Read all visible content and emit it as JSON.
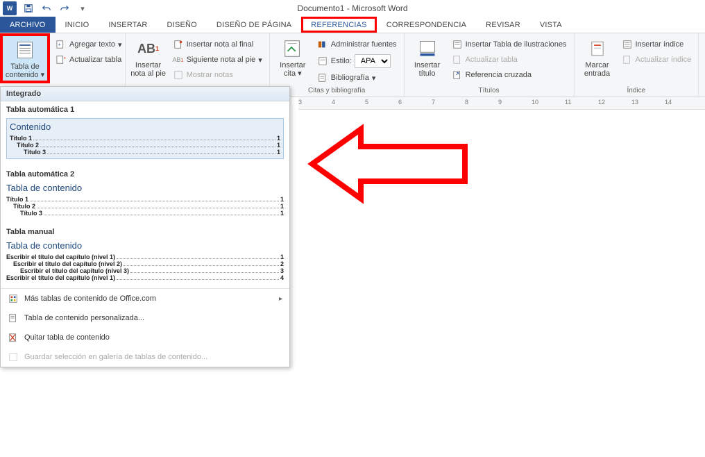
{
  "titlebar": {
    "title": "Documento1 - Microsoft Word"
  },
  "tabs": {
    "file": "ARCHIVO",
    "home": "INICIO",
    "insert": "INSERTAR",
    "design": "DISEÑO",
    "layout": "DISEÑO DE PÁGINA",
    "references": "REFERENCIAS",
    "mailings": "CORRESPONDENCIA",
    "review": "REVISAR",
    "view": "VISTA"
  },
  "ribbon": {
    "toc": {
      "label": "Tabla de\ncontenido",
      "add_text": "Agregar texto",
      "update": "Actualizar tabla"
    },
    "footnotes": {
      "big": "Insertar\nnota al pie",
      "endnote": "Insertar nota al final",
      "next": "Siguiente nota al pie",
      "show": "Mostrar notas"
    },
    "citations": {
      "big": "Insertar\ncita",
      "manage": "Administrar fuentes",
      "style_label": "Estilo:",
      "style_value": "APA",
      "biblio": "Bibliografía",
      "group": "Citas y bibliografía"
    },
    "captions": {
      "big": "Insertar\ntítulo",
      "insert_tof": "Insertar Tabla de ilustraciones",
      "update": "Actualizar tabla",
      "crossref": "Referencia cruzada",
      "group": "Títulos"
    },
    "index": {
      "big": "Marcar\nentrada",
      "insert": "Insertar índice",
      "update": "Actualizar índice",
      "group": "Índice"
    }
  },
  "ruler": [
    "3",
    "4",
    "5",
    "6",
    "7",
    "8",
    "9",
    "10",
    "11",
    "12",
    "13",
    "14"
  ],
  "gallery": {
    "header": "Integrado",
    "auto1": {
      "name": "Tabla automática 1",
      "title": "Contenido",
      "lines": [
        {
          "txt": "Título 1",
          "pg": "1",
          "indent": 0
        },
        {
          "txt": "Título 2",
          "pg": "1",
          "indent": 1
        },
        {
          "txt": "Título 3",
          "pg": "1",
          "indent": 2
        }
      ]
    },
    "auto2": {
      "name": "Tabla automática 2",
      "title": "Tabla de contenido",
      "lines": [
        {
          "txt": "Título 1",
          "pg": "1",
          "indent": 0
        },
        {
          "txt": "Título 2",
          "pg": "1",
          "indent": 1
        },
        {
          "txt": "Título 3",
          "pg": "1",
          "indent": 2
        }
      ]
    },
    "manual": {
      "name": "Tabla manual",
      "title": "Tabla de contenido",
      "lines": [
        {
          "txt": "Escribir el título del capítulo (nivel 1)",
          "pg": "1",
          "indent": 0
        },
        {
          "txt": "Escribir el título del capítulo (nivel 2)",
          "pg": "2",
          "indent": 1
        },
        {
          "txt": "Escribir el título del capítulo (nivel 3)",
          "pg": "3",
          "indent": 2
        },
        {
          "txt": "Escribir el título del capítulo (nivel 1)",
          "pg": "4",
          "indent": 0
        }
      ]
    },
    "more": "Más tablas de contenido de Office.com",
    "custom": "Tabla de contenido personalizada...",
    "remove": "Quitar tabla de contenido",
    "save": "Guardar selección en galería de tablas de contenido..."
  }
}
